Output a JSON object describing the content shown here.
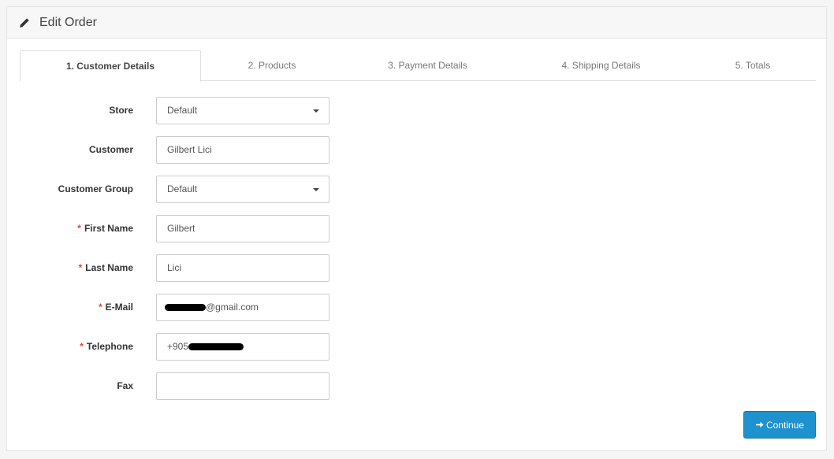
{
  "header": {
    "title": "Edit Order",
    "icon": "pencil-icon"
  },
  "tabs": [
    {
      "label": "1. Customer Details",
      "active": true
    },
    {
      "label": "2. Products",
      "active": false
    },
    {
      "label": "3. Payment Details",
      "active": false
    },
    {
      "label": "4. Shipping Details",
      "active": false
    },
    {
      "label": "5. Totals",
      "active": false
    }
  ],
  "form": {
    "store": {
      "label": "Store",
      "value": "Default"
    },
    "customer": {
      "label": "Customer",
      "value": "Gilbert Lici"
    },
    "customer_group": {
      "label": "Customer Group",
      "value": "Default"
    },
    "first_name": {
      "label": "First Name",
      "value": "Gilbert",
      "required": "*"
    },
    "last_name": {
      "label": "Last Name",
      "value": "Lici",
      "required": "*"
    },
    "email": {
      "label": "E-Mail",
      "value_visible": "@gmail.com",
      "required": "*"
    },
    "telephone": {
      "label": "Telephone",
      "value_visible": "+905",
      "required": "*"
    },
    "fax": {
      "label": "Fax",
      "value": ""
    }
  },
  "actions": {
    "continue_label": "Continue",
    "continue_icon": "arrow-right-icon"
  },
  "colors": {
    "primary": "#1e91cf",
    "required": "#e0452b"
  }
}
